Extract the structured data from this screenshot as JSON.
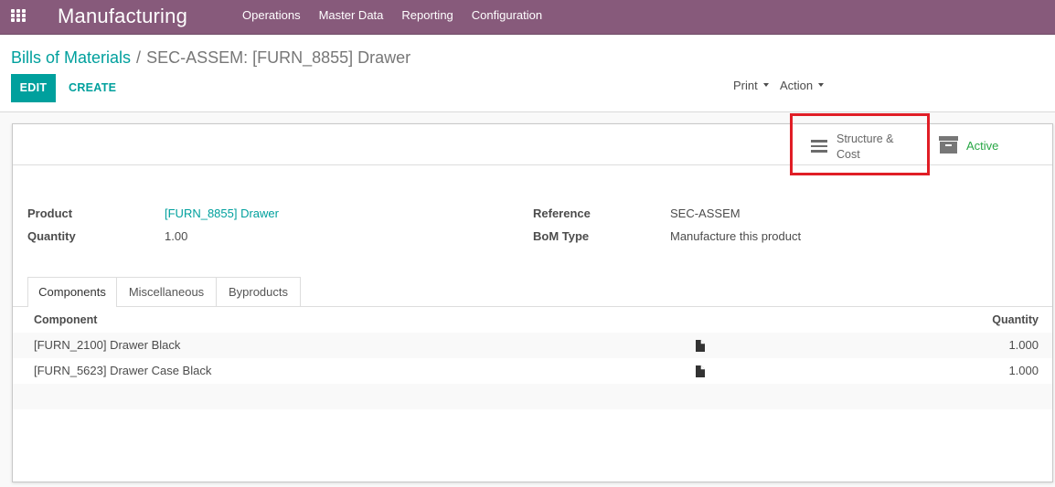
{
  "navbar": {
    "brand": "Manufacturing",
    "menu": [
      "Operations",
      "Master Data",
      "Reporting",
      "Configuration"
    ]
  },
  "breadcrumb": {
    "parent": "Bills of Materials",
    "separator": "/",
    "current": "SEC-ASSEM: [FURN_8855] Drawer"
  },
  "toolbar": {
    "edit_label": "EDIT",
    "create_label": "CREATE",
    "print_label": "Print",
    "action_label": "Action"
  },
  "button_box": {
    "structure_cost_label": "Structure & Cost",
    "active_label": "Active"
  },
  "fields": {
    "product_label": "Product",
    "product_value": "[FURN_8855] Drawer",
    "quantity_label": "Quantity",
    "quantity_value": "1.00",
    "reference_label": "Reference",
    "reference_value": "SEC-ASSEM",
    "bom_type_label": "BoM Type",
    "bom_type_value": "Manufacture this product"
  },
  "tabs": [
    "Components",
    "Miscellaneous",
    "Byproducts"
  ],
  "active_tab": "Components",
  "table": {
    "headers": {
      "component": "Component",
      "quantity": "Quantity"
    },
    "rows": [
      {
        "component": "[FURN_2100] Drawer Black",
        "icon": "file-icon",
        "quantity": "1.000"
      },
      {
        "component": "[FURN_5623] Drawer Case Black",
        "icon": "file-icon",
        "quantity": "1.000"
      }
    ]
  },
  "colors": {
    "navbar": "#875a7b",
    "primary": "#00a09d",
    "active_green": "#28a745",
    "highlight_red": "#e01e26"
  }
}
